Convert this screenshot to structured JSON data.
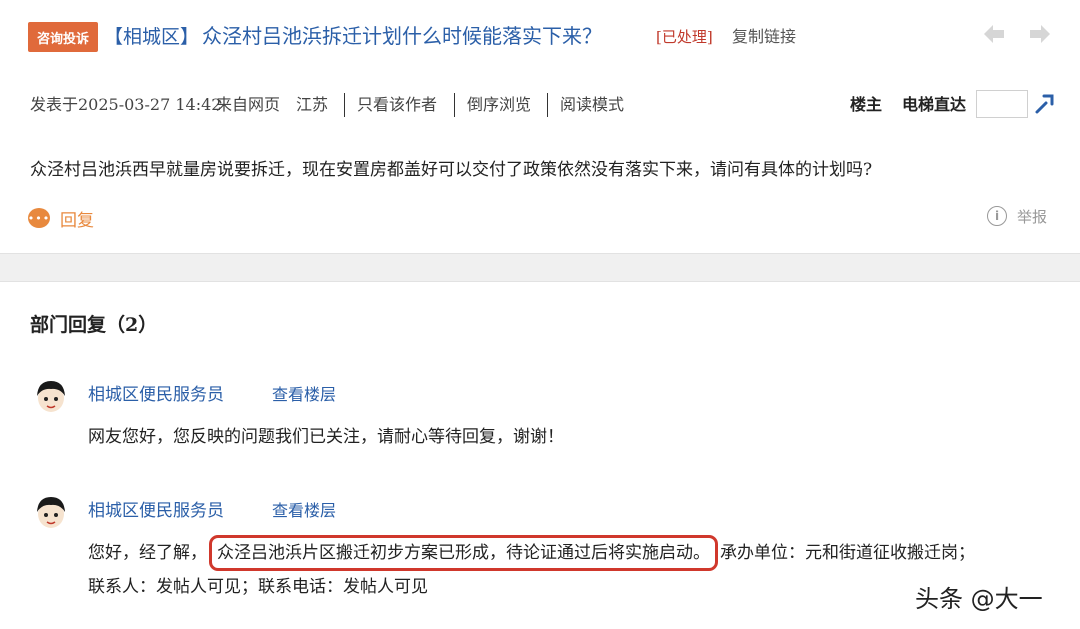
{
  "post": {
    "consult_tag": "咨询投诉",
    "district": "【相城区】",
    "title": "众泾村吕池浜拆迁计划什么时候能落实下来？",
    "status": "[已处理]",
    "copy_link": "复制链接",
    "meta": {
      "posted": "发表于2025-03-27 14:42",
      "source": "来自网页",
      "region": "江苏",
      "author_only": "只看该作者",
      "reverse": "倒序浏览",
      "read_mode": "阅读模式"
    },
    "floor_owner": "楼主",
    "jump_label": "电梯直达",
    "jump_value": "",
    "body": "众泾村吕池浜西早就量房说要拆迁，现在安置房都盖好可以交付了政策依然没有落实下来，请问有具体的计划吗?",
    "reply_label": "回复",
    "report_label": "举报"
  },
  "replies_section": {
    "heading": "部门回复（2）",
    "replies": [
      {
        "name": "相城区便民服务员",
        "floor_link": "查看楼层",
        "text": "网友您好，您反映的问题我们已关注，请耐心等待回复，谢谢！"
      },
      {
        "name": "相城区便民服务员",
        "floor_link": "查看楼层",
        "text_before": "您好，经了解，",
        "text_highlight": "众泾吕池浜片区搬迁初步方案已形成，待论证通过后将实施启动。",
        "text_after": "承办单位：元和街道征收搬迁岗；",
        "text_line2": "联系人：发帖人可见；联系电话：发帖人可见"
      }
    ]
  },
  "watermark": "头条 @大一",
  "colors": {
    "link_blue": "#2b5fa8",
    "tag_orange": "#e06a3b",
    "status_red": "#c0392b",
    "reply_orange": "#e8893e",
    "highlight_red": "#d0382c"
  }
}
